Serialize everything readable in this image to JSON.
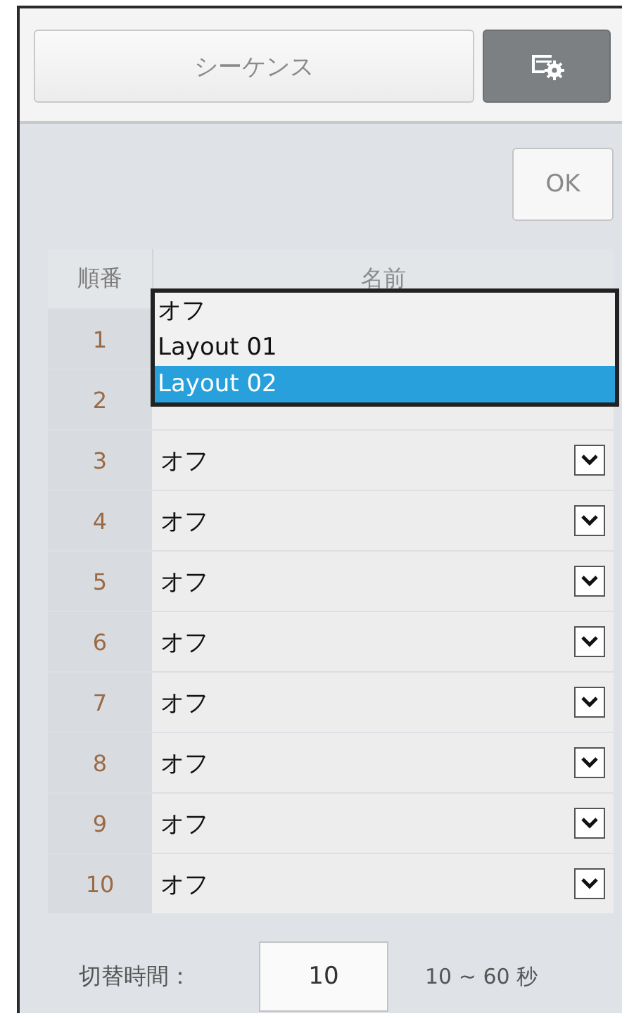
{
  "tabs": [
    {
      "label": "シーケンス",
      "kind": "text",
      "selected": false
    },
    {
      "kind": "icon",
      "selected": true
    }
  ],
  "ok_button": "OK",
  "table": {
    "columns": [
      "順番",
      "名前"
    ],
    "rows": [
      {
        "number": "1"
      },
      {
        "number": "2"
      },
      {
        "number": "3",
        "value": "オフ"
      },
      {
        "number": "4",
        "value": "オフ"
      },
      {
        "number": "5",
        "value": "オフ"
      },
      {
        "number": "6",
        "value": "オフ"
      },
      {
        "number": "7",
        "value": "オフ"
      },
      {
        "number": "8",
        "value": "オフ"
      },
      {
        "number": "9",
        "value": "オフ"
      },
      {
        "number": "10",
        "value": "オフ"
      }
    ]
  },
  "dropdown": {
    "options": [
      {
        "label": "オフ",
        "selected": false
      },
      {
        "label": "Layout 01",
        "selected": false
      },
      {
        "label": "Layout 02",
        "selected": true
      }
    ]
  },
  "footer": {
    "label": "切替時間：",
    "value": "10",
    "range": "10 ~ 60 秒"
  }
}
